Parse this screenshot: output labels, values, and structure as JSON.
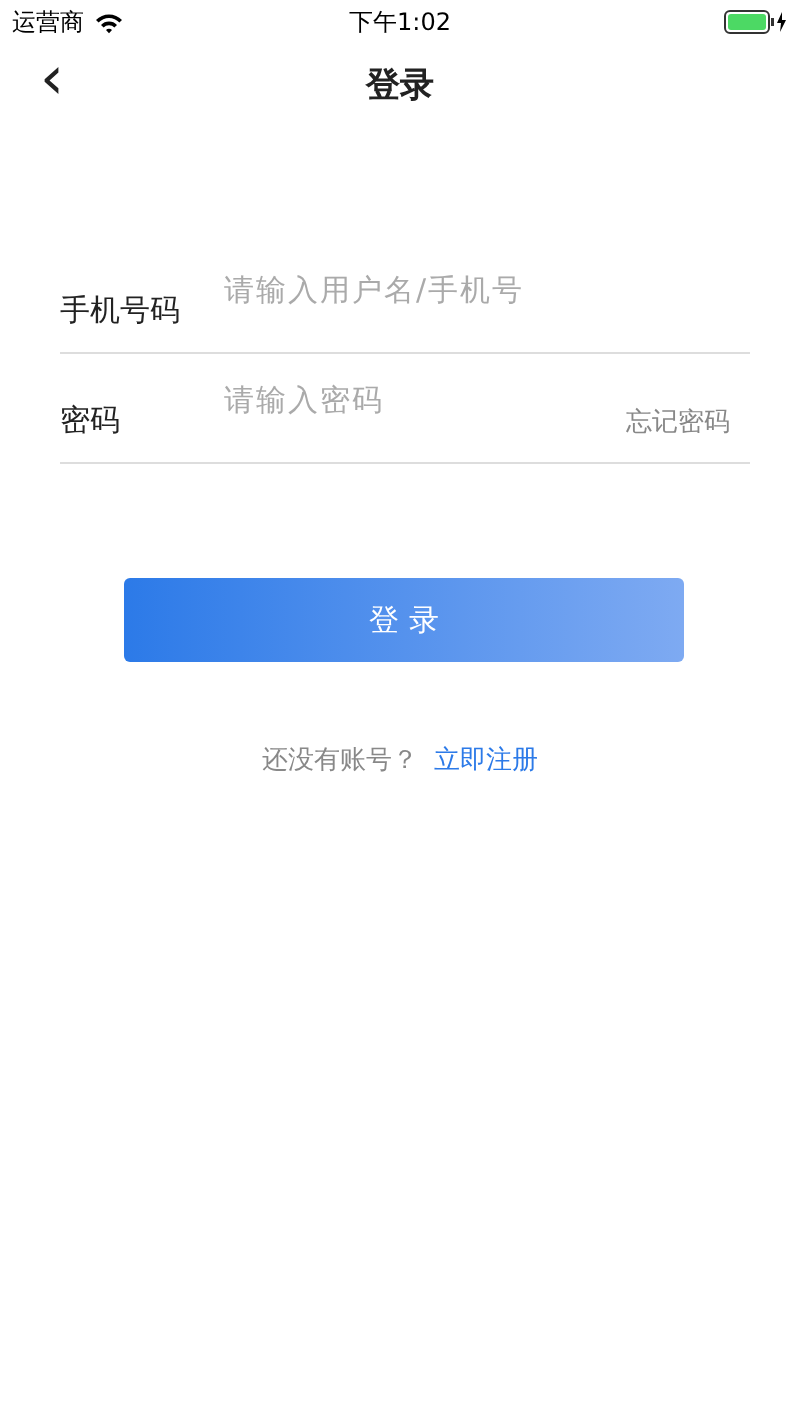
{
  "status_bar": {
    "carrier": "运营商",
    "time": "下午1:02"
  },
  "nav": {
    "back": "‹",
    "title": "登录"
  },
  "fields": [
    {
      "label": "手机号码",
      "placeholder": "请输入用户名/手机号"
    },
    {
      "label": "密码",
      "placeholder": "请输入密码",
      "action": "忘记密码"
    }
  ],
  "submit": "登 录",
  "register": {
    "prompt": "还没有账号？",
    "link": "立即注册"
  }
}
